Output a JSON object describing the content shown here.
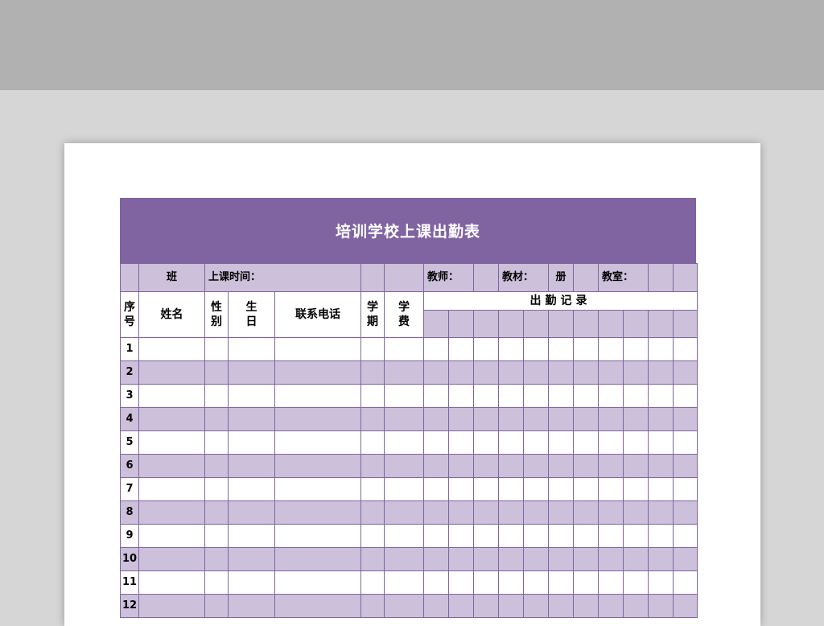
{
  "sheet": {
    "title": "培训学校上课出勤表",
    "class_label": "班",
    "time_label": "上课时间：",
    "teacher_label": "教师：",
    "textbook_label": "教材：",
    "book_label": "册",
    "classroom_label": "教室：",
    "headers": {
      "seq": "序号",
      "name": "姓名",
      "gender": "性别",
      "birthday": "生日",
      "phone": "联系电话",
      "term": "学期",
      "fee": "学费",
      "attendance": "出勤记录"
    },
    "rows": [
      "1",
      "2",
      "3",
      "4",
      "5",
      "6",
      "7",
      "8",
      "9",
      "10",
      "11",
      "12"
    ]
  },
  "colors": {
    "accent": "#8064a2",
    "light_accent": "#ccc0da",
    "background": "#d6d6d6",
    "top_band": "#b1b1b1"
  }
}
